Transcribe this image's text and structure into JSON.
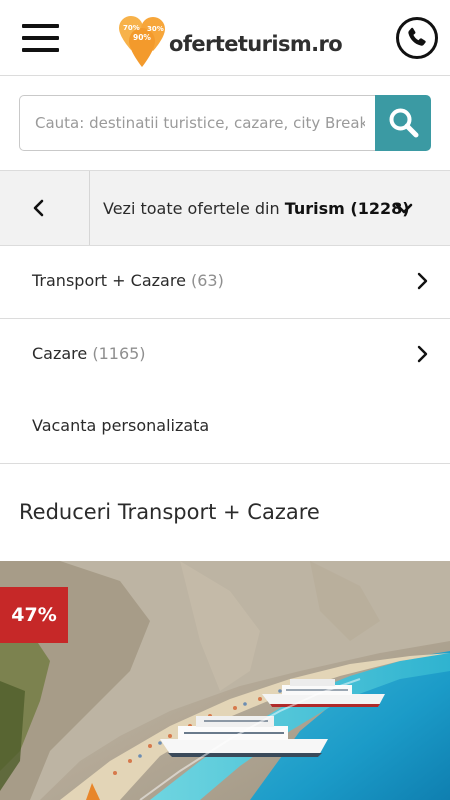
{
  "header": {
    "menu_icon": "hamburger-menu-icon",
    "logo": {
      "text": "oferteturism.ro",
      "pins": [
        "70%",
        "90%",
        "30%"
      ]
    },
    "phone_icon": "phone-icon"
  },
  "search": {
    "placeholder": "Cauta: destinatii turistice, cazare, city Break",
    "icon": "search-icon"
  },
  "category_bar": {
    "back_icon": "chevron-left-icon",
    "prefix": "Vezi toate ofertele din ",
    "category": "Turism (1228)",
    "dropdown_icon": "chevron-down-icon"
  },
  "subcategories": [
    {
      "label": "Transport + Cazare",
      "count": "(63)",
      "icon": "chevron-right-icon"
    },
    {
      "label": "Cazare",
      "count": "(1165)",
      "icon": "chevron-right-icon"
    },
    {
      "label": "Vacanta personalizata",
      "count": ""
    }
  ],
  "section": {
    "title": "Reduceri Transport + Cazare"
  },
  "promo": {
    "discount": "47%"
  },
  "colors": {
    "accent": "#3b9aa3",
    "badge": "#c62828",
    "logo_orange": "#f39a2c",
    "bar_bg": "#f2f2f2"
  }
}
